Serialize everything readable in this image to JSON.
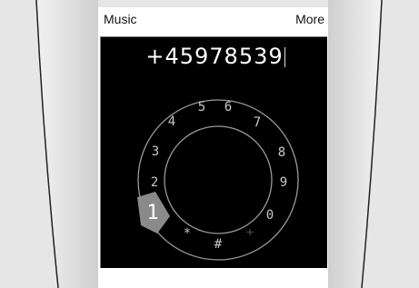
{
  "softkeys": {
    "left_label": "Music",
    "right_label": "More"
  },
  "dialer": {
    "entered_number": "+45978539",
    "selected_digit": "1",
    "digits": [
      "5",
      "6",
      "4",
      "7",
      "3",
      "8",
      "2",
      "9",
      "0",
      "*",
      "#",
      "+"
    ]
  },
  "colors": {
    "screen_background": "#000000",
    "digit_color": "#c8c8c8",
    "selected_marker": "#8a8a8a"
  }
}
